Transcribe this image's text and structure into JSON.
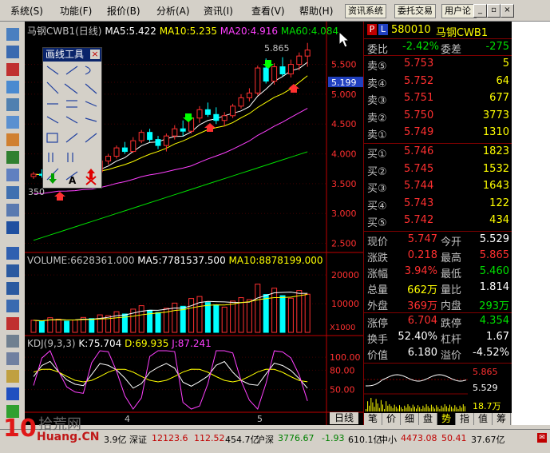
{
  "menu": {
    "items": [
      "系统(S)",
      "功能(F)",
      "报价(B)",
      "分析(A)",
      "资讯(I)",
      "查看(V)",
      "帮助(H)"
    ],
    "buttons": [
      "资讯系统",
      "委托交易",
      "用户论"
    ]
  },
  "chart": {
    "title": "马钢CWB1(日线)",
    "ma5": "MA5:5.422",
    "ma10": "MA10:5.235",
    "ma20": "MA20:4.916",
    "ma60": "MA60:4.084",
    "high_label": "5.865",
    "low_label": "350",
    "price_ticks": [
      "5.500",
      "5.199",
      "5.000",
      "4.500",
      "4.000",
      "3.500",
      "3.000",
      "2.500"
    ],
    "volume_title": "VOLUME:6628361.000",
    "vol_ma5": "MA5:7781537.500",
    "vol_ma10": "MA10:8878199.000",
    "vol_ticks": [
      "20000",
      "10000",
      "X1000"
    ],
    "kdj_title": "KDJ(9,3,3)",
    "kdj_k": "K:75.704",
    "kdj_d": "D:69.935",
    "kdj_j": "J:87.241",
    "kdj_ticks": [
      "100.00",
      "80.00",
      "50.00"
    ],
    "date_labels": [
      "4",
      "5"
    ],
    "period_tab": "日线"
  },
  "chart_data": {
    "type": "candlestick",
    "candles": [
      [
        3.62,
        3.7,
        3.58,
        3.66
      ],
      [
        3.66,
        3.74,
        3.6,
        3.64
      ],
      [
        3.64,
        3.72,
        3.56,
        3.7
      ],
      [
        3.7,
        3.78,
        3.66,
        3.72
      ],
      [
        3.72,
        3.76,
        3.62,
        3.66
      ],
      [
        3.66,
        3.7,
        3.6,
        3.68
      ],
      [
        3.68,
        3.8,
        3.64,
        3.76
      ],
      [
        3.76,
        3.82,
        3.68,
        3.7
      ],
      [
        3.7,
        3.92,
        3.68,
        3.88
      ],
      [
        3.88,
        4.0,
        3.82,
        3.96
      ],
      [
        3.96,
        4.14,
        3.92,
        4.1
      ],
      [
        4.1,
        4.2,
        4.0,
        4.04
      ],
      [
        4.04,
        4.28,
        4.02,
        4.22
      ],
      [
        4.22,
        4.4,
        4.18,
        4.36
      ],
      [
        4.36,
        4.42,
        4.2,
        4.24
      ],
      [
        4.24,
        4.3,
        4.08,
        4.14
      ],
      [
        4.14,
        4.34,
        4.04,
        4.3
      ],
      [
        4.3,
        4.48,
        4.24,
        4.42
      ],
      [
        4.42,
        4.56,
        4.3,
        4.38
      ],
      [
        4.38,
        4.66,
        4.34,
        4.6
      ],
      [
        4.6,
        4.8,
        4.52,
        4.74
      ],
      [
        4.74,
        4.86,
        4.62,
        4.66
      ],
      [
        4.66,
        4.78,
        4.5,
        4.56
      ],
      [
        4.56,
        4.7,
        4.46,
        4.64
      ],
      [
        4.64,
        4.84,
        4.6,
        4.8
      ],
      [
        4.8,
        5.0,
        4.76,
        4.94
      ],
      [
        4.94,
        5.1,
        4.88,
        5.02
      ],
      [
        5.02,
        5.48,
        4.98,
        5.44
      ],
      [
        5.44,
        5.6,
        5.18,
        5.22
      ],
      [
        5.22,
        5.52,
        5.16,
        5.46
      ],
      [
        5.46,
        5.62,
        5.3,
        5.34
      ],
      [
        5.34,
        5.58,
        5.28,
        5.5
      ],
      [
        5.5,
        5.7,
        5.4,
        5.64
      ],
      [
        5.64,
        5.86,
        5.46,
        5.74
      ]
    ],
    "volumes": [
      4200,
      3800,
      5100,
      4600,
      3900,
      4300,
      5200,
      4800,
      6100,
      5800,
      7200,
      6400,
      8100,
      9300,
      7700,
      6900,
      8400,
      10200,
      9100,
      11800,
      12500,
      10400,
      9600,
      8800,
      10900,
      12100,
      11400,
      16800,
      13200,
      15400,
      12800,
      11900,
      14600,
      13300
    ],
    "y_range": [
      2.4,
      5.95
    ],
    "volume_range": [
      0,
      22000
    ],
    "kdj_range": [
      20,
      110
    ]
  },
  "quote": {
    "code": "580010",
    "name": "马钢CWB1",
    "weibi_label": "委比",
    "weibi": "-2.42%",
    "weicha_label": "委差",
    "weicha": "-275",
    "sell": [
      {
        "l": "卖⑤",
        "p": "5.753",
        "v": "5"
      },
      {
        "l": "卖④",
        "p": "5.752",
        "v": "64"
      },
      {
        "l": "卖③",
        "p": "5.751",
        "v": "677"
      },
      {
        "l": "卖②",
        "p": "5.750",
        "v": "3773"
      },
      {
        "l": "卖①",
        "p": "5.749",
        "v": "1310"
      }
    ],
    "buy": [
      {
        "l": "买①",
        "p": "5.746",
        "v": "1823"
      },
      {
        "l": "买②",
        "p": "5.745",
        "v": "1532"
      },
      {
        "l": "买③",
        "p": "5.744",
        "v": "1643"
      },
      {
        "l": "买④",
        "p": "5.743",
        "v": "122"
      },
      {
        "l": "买⑤",
        "p": "5.742",
        "v": "434"
      }
    ],
    "stats": [
      {
        "l1": "现价",
        "v1": "5.747",
        "l2": "今开",
        "v2": "5.529"
      },
      {
        "l1": "涨跌",
        "v1": "0.218",
        "l2": "最高",
        "v2": "5.865"
      },
      {
        "l1": "涨幅",
        "v1": "3.94%",
        "l2": "最低",
        "v2": "5.460"
      },
      {
        "l1": "总量",
        "v1": "662万",
        "l2": "量比",
        "v2": "1.814"
      },
      {
        "l1": "外盘",
        "v1": "369万",
        "l2": "内盘",
        "v2": "293万"
      }
    ],
    "stats2": [
      {
        "l1": "涨停",
        "v1": "6.704",
        "l2": "跌停",
        "v2": "4.354"
      },
      {
        "l1": "换手",
        "v1": "52.40%",
        "l2": "杠杆",
        "v2": "1.67"
      },
      {
        "l1": "价值",
        "v1": "6.180",
        "l2": "溢价",
        "v2": "-4.52%"
      }
    ],
    "mini": {
      "hi": "5.865",
      "mid": "5.529",
      "vol": "18.7万"
    },
    "tabs": [
      "笔",
      "价",
      "细",
      "盘",
      "势",
      "指",
      "值",
      "筹"
    ]
  },
  "drawtool": {
    "title": "画线工具"
  },
  "status": {
    "s1": "3.9亿",
    "s2n": "深证",
    "s2v": "12123.6",
    "s2c": "112.52",
    "s2a": "454.7亿",
    "s3n": "沪深",
    "s3v": "3776.67",
    "s3c": "-1.93",
    "s3a": "610.1亿",
    "s4n": "中小",
    "s4v": "4473.08",
    "s4c": "50.41",
    "s4a": "37.67亿"
  },
  "watermark": {
    "num": "10",
    "text": "拾荒网",
    "url": "Huang.CN"
  }
}
